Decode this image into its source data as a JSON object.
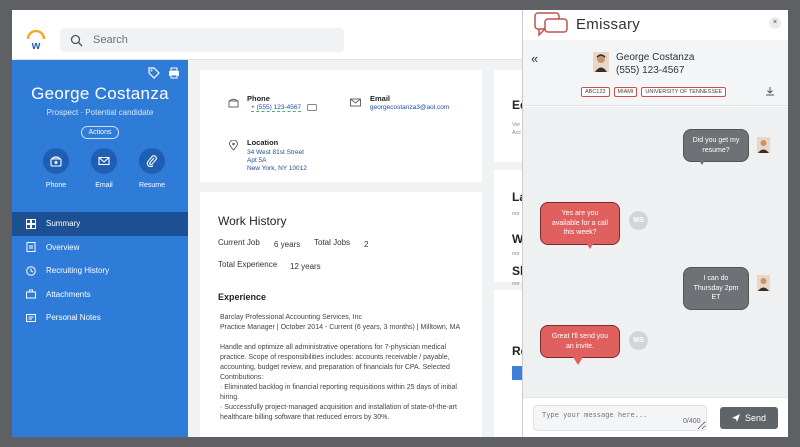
{
  "topbar": {
    "search_placeholder": "Search"
  },
  "profile": {
    "name": "George Costanza",
    "subtitle": "Prospect · Potential candidate",
    "actions_label": "Actions",
    "quick_actions": [
      {
        "label": "Phone",
        "icon": "phone-icon"
      },
      {
        "label": "Email",
        "icon": "email-icon"
      },
      {
        "label": "Resume",
        "icon": "paperclip-icon"
      }
    ],
    "nav": [
      {
        "label": "Summary",
        "icon": "grid-icon",
        "active": true
      },
      {
        "label": "Overview",
        "icon": "document-icon"
      },
      {
        "label": "Recruiting History",
        "icon": "clock-icon"
      },
      {
        "label": "Attachments",
        "icon": "briefcase-icon"
      },
      {
        "label": "Personal Notes",
        "icon": "notes-icon"
      }
    ]
  },
  "contact": {
    "phone_label": "Phone",
    "phone_value": "+ (555) 123-4567",
    "email_label": "Email",
    "email_value": "georgecostanza3@aol.com",
    "location_label": "Location",
    "address_line1": "34 West 81st Street",
    "address_line2": "Apt 5A",
    "address_line3": "New York, NY 10012"
  },
  "work_history": {
    "title": "Work History",
    "current_job_label": "Current Job",
    "current_job_value": "6 years",
    "total_jobs_label": "Total Jobs",
    "total_jobs_value": "2",
    "total_experience_label": "Total Experience",
    "total_experience_value": "12 years",
    "experience_heading": "Experience",
    "company": "Barclay Professional Accounting Services, Inc",
    "role_line": "Practice Manager | October 2014 - Current (6 years, 3 months) | Milltown, MA",
    "description": "Handle and optimize all administrative operations for 7-physician medical practice. Scope of responsibilities includes: accounts receivable / payable, accounting, budget review, and preparation of financials for CPA. Selected Contributions:",
    "bullet1": "· Eliminated backlog in financial reporting requisitions within 25 days of initial hiring.",
    "bullet2": "· Successfully project-managed acquisition and installation of state-of-the-art healthcare billing software that reduced errors by 30%."
  },
  "right_cards": {
    "card1_heading": "Ed",
    "card1_line1": "Ver",
    "card1_line2": "Acc",
    "card2_heading1": "La",
    "card2_text1": "nor",
    "card2_heading2": "W",
    "card2_text2": "nor",
    "card2_heading3": "Sk",
    "card2_text3": "nor",
    "card3_heading": "Re"
  },
  "emissary": {
    "title": "Emissary",
    "close": "×",
    "contact_name": "George Costanza",
    "contact_phone": "(555) 123-4567",
    "tags": [
      "ABC123",
      "MIAMI",
      "UNIVERSITY OF TENNESSEE"
    ],
    "messages": [
      {
        "from": "contact",
        "text": "Did you get my resume?"
      },
      {
        "from": "me",
        "initials": "MS",
        "text": "Yes are you available for a call this week?"
      },
      {
        "from": "contact",
        "text": "I can do Thursday 2pm ET"
      },
      {
        "from": "me",
        "initials": "MS",
        "text": "Great I'll send you an invite."
      }
    ],
    "input_placeholder": "Type your message here...",
    "counter": "0/400",
    "send_label": "Send"
  }
}
